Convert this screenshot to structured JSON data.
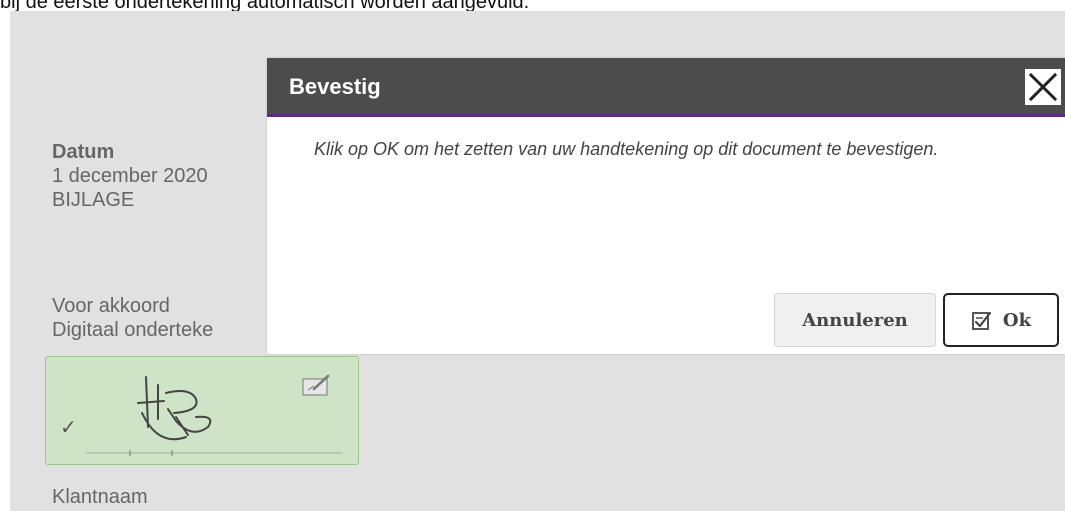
{
  "top_text": "bij de eerste ondertekening automatisch worden aangevuld.",
  "document": {
    "date_label": "Datum",
    "date_value": "1 december 2020",
    "attachment": "BIJLAGE",
    "approval": "Voor akkoord",
    "digital_signed": "Digitaal onderteke",
    "signature_check": "✓",
    "customer_name": "Klantnaam"
  },
  "dialog": {
    "title": "Bevestig",
    "message": "Klik op OK om het zetten van uw handtekening op dit document te bevestigen.",
    "cancel_label": "Annuleren",
    "ok_label": "Ok"
  },
  "icons": {
    "close": "close-icon",
    "ok": "sign-check-icon",
    "edit_signature": "edit-signature-icon"
  },
  "colors": {
    "header_bg": "#4c4c4c",
    "header_accent": "#5b2d82",
    "signature_bg": "#cfe3c6",
    "page_bg": "#e1e1e1"
  }
}
